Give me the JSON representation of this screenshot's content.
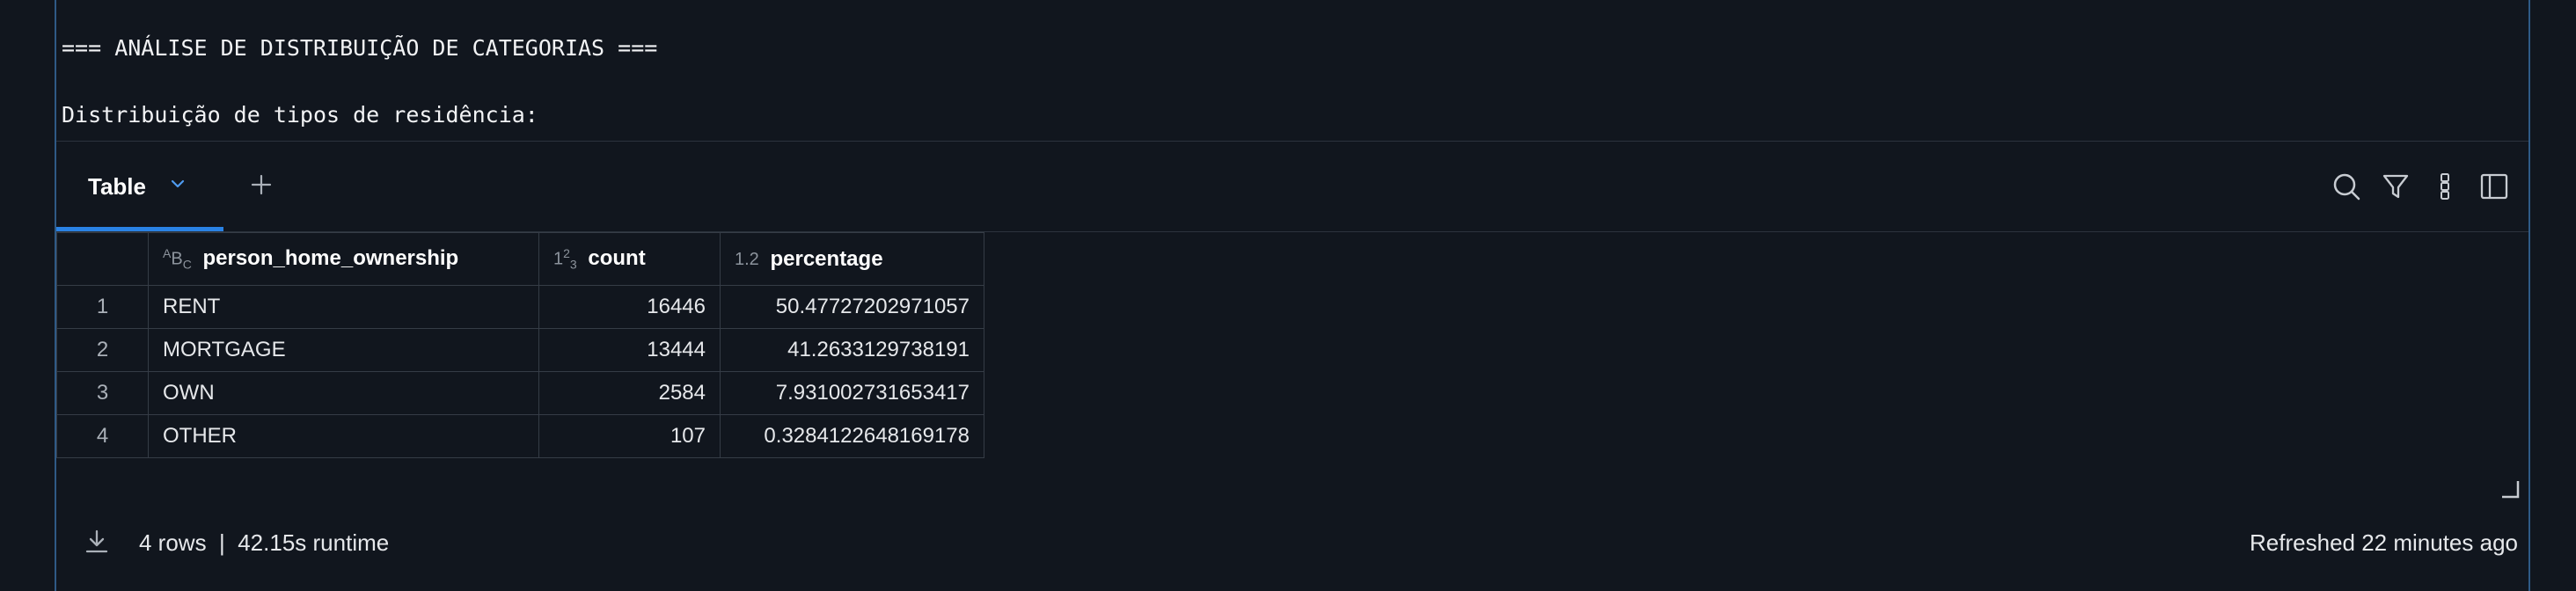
{
  "output": {
    "line1": "=== ANÁLISE DE DISTRIBUIÇÃO DE CATEGORIAS ===",
    "line2": "Distribuição de tipos de residência:"
  },
  "tabs": {
    "active_label": "Table"
  },
  "table": {
    "columns": [
      {
        "type_icon": "ABC",
        "label": "person_home_ownership"
      },
      {
        "type_icon": "123",
        "label": "count"
      },
      {
        "type_icon": "1.2",
        "label": "percentage"
      }
    ],
    "rows": [
      {
        "index": "1",
        "person_home_ownership": "RENT",
        "count": "16446",
        "percentage": "50.47727202971057"
      },
      {
        "index": "2",
        "person_home_ownership": "MORTGAGE",
        "count": "13444",
        "percentage": "41.2633129738191"
      },
      {
        "index": "3",
        "person_home_ownership": "OWN",
        "count": "2584",
        "percentage": "7.931002731653417"
      },
      {
        "index": "4",
        "person_home_ownership": "OTHER",
        "count": "107",
        "percentage": "0.3284122648169178"
      }
    ]
  },
  "footer": {
    "summary": "4 rows  |  42.15s runtime",
    "refreshed": "Refreshed 22 minutes ago"
  },
  "colors": {
    "background": "#11161e",
    "accent": "#2a82e4",
    "frame": "#2f5a86"
  },
  "icons": [
    "chevron-down-icon",
    "plus-icon",
    "search-icon",
    "filter-icon",
    "more-vertical-icon",
    "sidebar-panel-icon",
    "download-icon",
    "resize-handle-icon"
  ]
}
